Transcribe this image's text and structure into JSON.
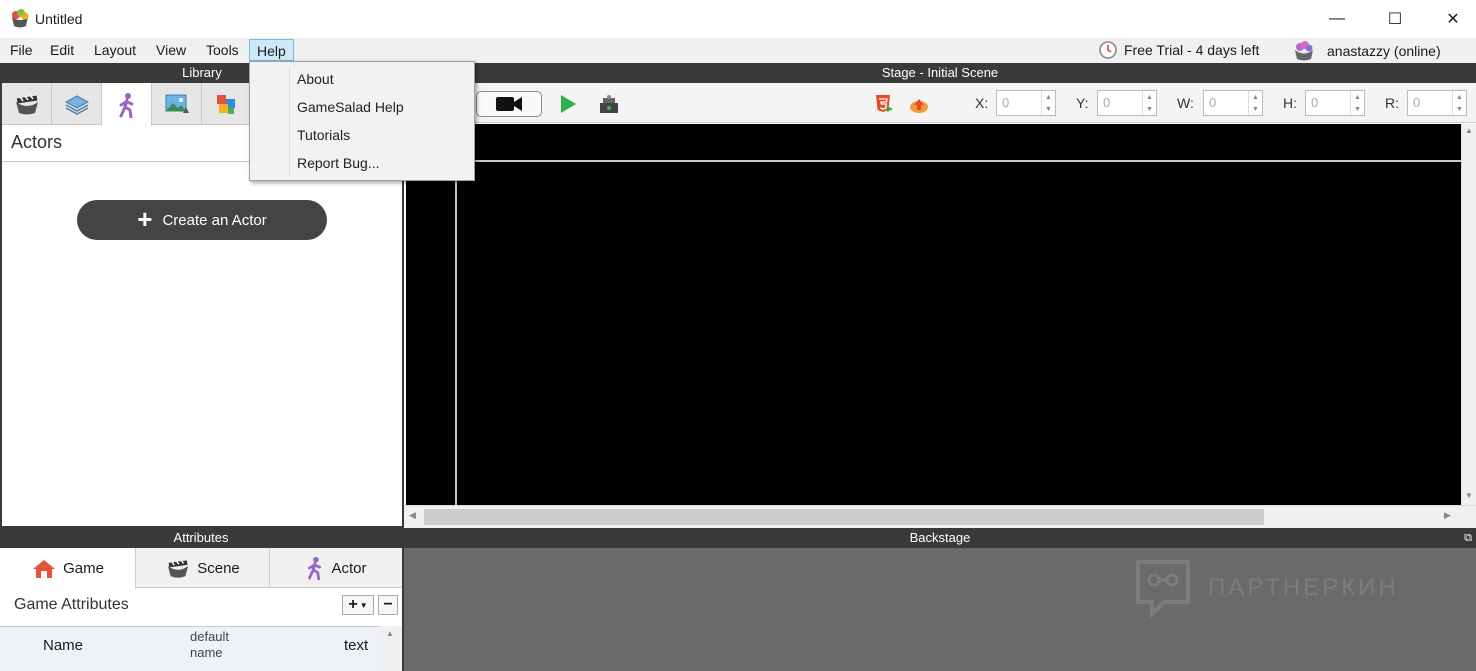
{
  "window": {
    "title": "Untitled",
    "minimize": "—",
    "maximize": "☐",
    "close": "✕"
  },
  "menubar": {
    "items": [
      {
        "label": "File"
      },
      {
        "label": "Edit"
      },
      {
        "label": "Layout"
      },
      {
        "label": "View"
      },
      {
        "label": "Tools"
      },
      {
        "label": "Help"
      }
    ],
    "trial": "Free Trial - 4 days left",
    "user": "anastazzy (online)"
  },
  "help_menu": {
    "items": [
      {
        "label": "About"
      },
      {
        "label": "GameSalad Help"
      },
      {
        "label": "Tutorials"
      },
      {
        "label": "Report Bug..."
      }
    ]
  },
  "library": {
    "header": "Library",
    "section_title": "Actors",
    "create_button": "Create an Actor"
  },
  "stage": {
    "header": "Stage - Initial Scene",
    "coords": [
      {
        "label": "X:",
        "value": "0"
      },
      {
        "label": "Y:",
        "value": "0"
      },
      {
        "label": "W:",
        "value": "0"
      },
      {
        "label": "H:",
        "value": "0"
      },
      {
        "label": "R:",
        "value": "0"
      }
    ]
  },
  "attributes": {
    "header": "Attributes",
    "tabs": [
      {
        "label": "Game"
      },
      {
        "label": "Scene"
      },
      {
        "label": "Actor"
      }
    ],
    "section_title": "Game Attributes",
    "row": {
      "name": "Name",
      "value_line1": "default",
      "value_line2": "name",
      "type": "text"
    }
  },
  "backstage": {
    "header": "Backstage",
    "watermark": "ПАРТНЕРКИН"
  },
  "colors": {
    "accent": "#cde8f8",
    "panel_header": "#3a3a3a",
    "backstage": "#6a6a6a",
    "stage": "#000000"
  }
}
